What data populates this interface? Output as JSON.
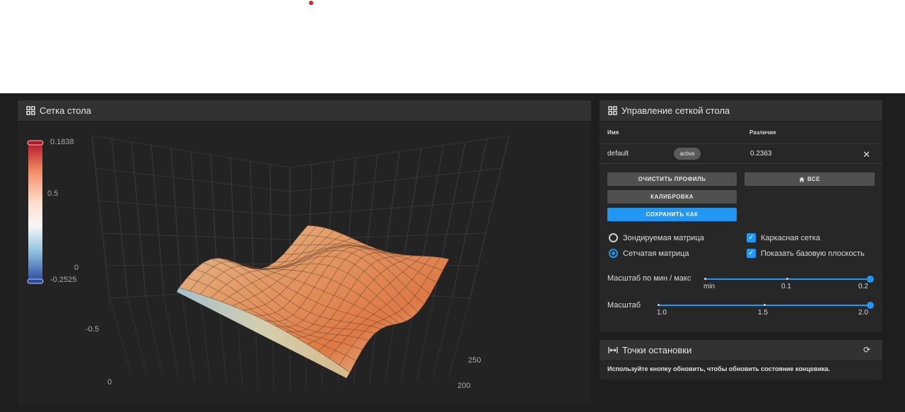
{
  "mesh_panel": {
    "title": "Сетка стола",
    "colorbar": {
      "max_label": "0.1838",
      "mid_label": "0.5",
      "zero_label": "0",
      "min_label": "-0.2525",
      "neg_label": "-0.5",
      "axis_zero": "0"
    },
    "axis_labels": {
      "y1": "250",
      "y2": "200"
    }
  },
  "control_panel": {
    "title": "Управление сеткой стола",
    "table": {
      "col_name": "Имя",
      "col_variance": "Различие",
      "rows": [
        {
          "name": "default",
          "status": "active",
          "variance": "0.2363"
        }
      ]
    },
    "buttons": {
      "clear_profile": "ОЧИСТИТЬ ПРОФИЛЬ",
      "home_all": "ВСЕ",
      "calibrate": "КАЛИБРОВКА",
      "save_as": "СОХРАНИТЬ КАК"
    },
    "options": {
      "probed_matrix": "Зондируемая матрица",
      "mesh_matrix": "Сетчатая матрица",
      "wireframe": "Каркасная сетка",
      "show_base_plane": "Показать базовую плоскость"
    },
    "scale_minmax": {
      "label": "Масштаб по мин / макс",
      "ticks": [
        "min",
        "0.1",
        "0.2"
      ],
      "value": "0.2"
    },
    "scale": {
      "label": "Масштаб",
      "ticks": [
        "1.0",
        "1.5",
        "2.0"
      ],
      "value": "2.0"
    }
  },
  "endstops_panel": {
    "title": "Точки остановки",
    "hint": "Используйте кнопку обновить, чтобы обновить состояние концевика."
  },
  "colors": {
    "accent": "#2196f3",
    "surface_high": "#e8703a",
    "surface_low": "#9ccae6"
  }
}
